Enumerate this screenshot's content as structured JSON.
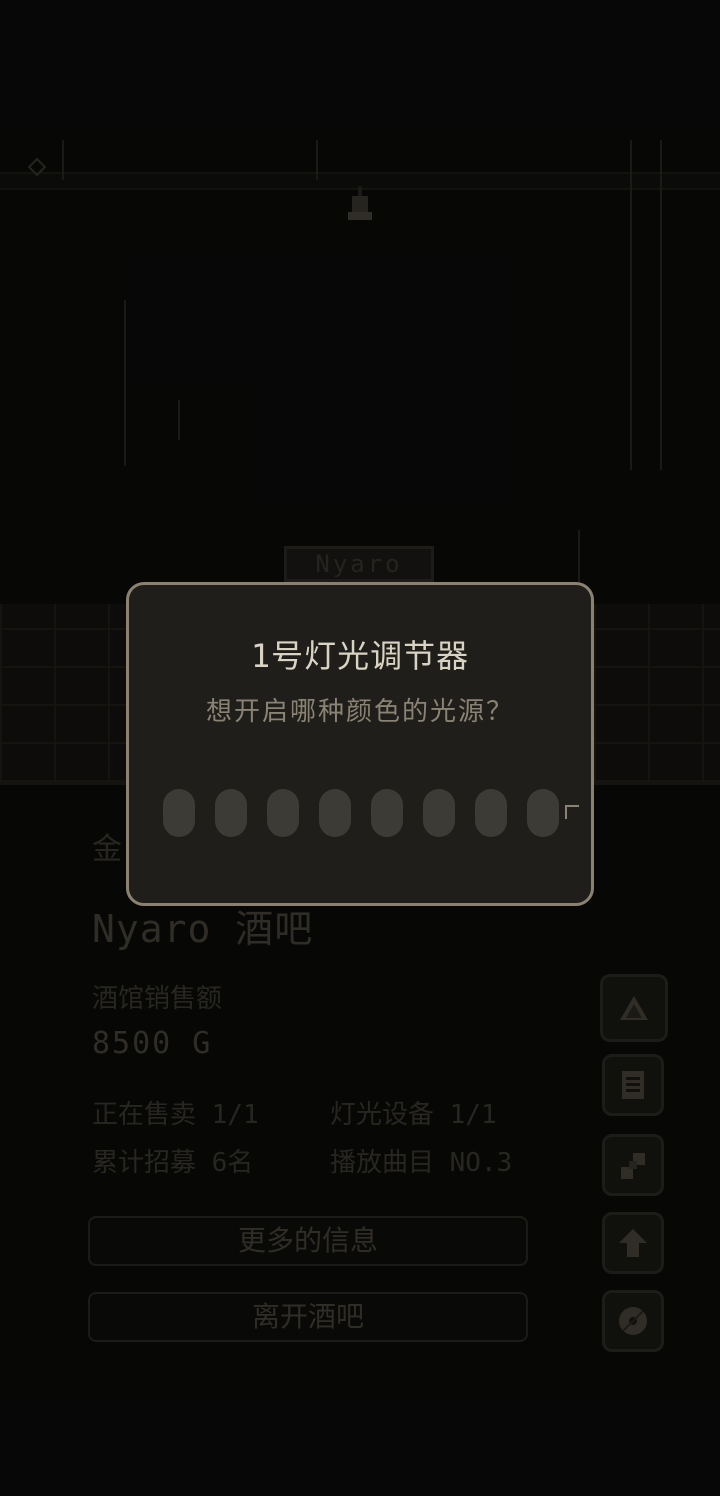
{
  "scene": {
    "sign_text": "Nyaro"
  },
  "dialog": {
    "title": "1号灯光调节器",
    "question": "想开启哪种颜色的光源？",
    "slot_count": 8
  },
  "info": {
    "gold_label": "金",
    "bar_name": "Nyaro 酒吧",
    "sales_label": "酒馆销售额",
    "sales_value": "8500 G",
    "stats": {
      "selling": "正在售卖 1/1",
      "lighting": "灯光设备 1/1",
      "recruited": "累计招募 6名",
      "track": "播放曲目 NO.3"
    },
    "more_info_button": "更多的信息",
    "leave_button": "离开酒吧"
  },
  "side_buttons": [
    {
      "icon": "decor-icon"
    },
    {
      "icon": "menu-list-icon"
    },
    {
      "icon": "tools-icon"
    },
    {
      "icon": "upgrade-arrow-icon"
    },
    {
      "icon": "music-disc-icon"
    }
  ],
  "colors": {
    "dialog_bg": "#1f1e1a",
    "dialog_border": "#8a8170",
    "title_text": "#d9d3c4",
    "slot_empty": "#3d3b35"
  }
}
